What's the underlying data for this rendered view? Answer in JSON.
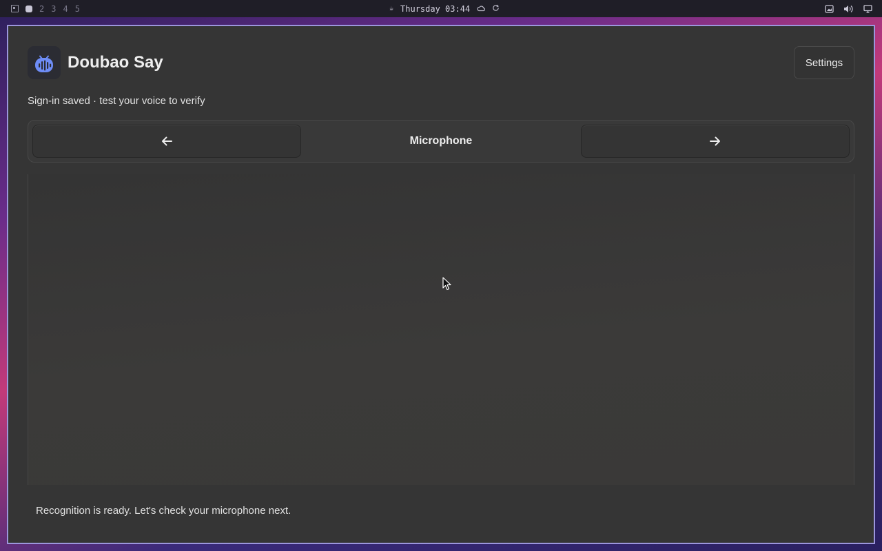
{
  "topbar": {
    "workspaces": [
      "2",
      "3",
      "4",
      "5"
    ],
    "clock": "Thursday 03:44",
    "icons": [
      "workspace-overview-icon",
      "active-workspace-icon",
      "coffee-icon",
      "cloud-icon",
      "refresh-icon",
      "screenshot-icon",
      "volume-icon",
      "display-icon"
    ]
  },
  "app": {
    "title": "Doubao Say",
    "icon": "voice-waveform-icon",
    "settings_label": "Settings",
    "subtitle": "Sign-in saved · test your voice to verify",
    "nav": {
      "prev_icon": "arrow-left-icon",
      "title": "Microphone",
      "next_icon": "arrow-right-icon"
    },
    "status": "Recognition is ready. Let's check your microphone next."
  },
  "colors": {
    "accent": "#9c96dc",
    "icon_blue": "#6e8df7",
    "window_bg": "#353535"
  }
}
